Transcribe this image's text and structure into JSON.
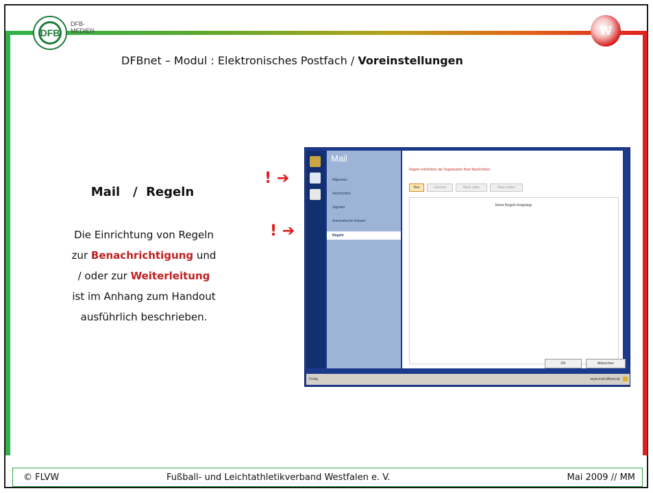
{
  "header": {
    "logo_dfb": "DFB",
    "logo_text_1": "DFB-",
    "logo_text_2": "MEDIEN",
    "logo_right": "W",
    "title_prefix": "DFBnet – Modul :  Elektronisches Postfach  /  ",
    "title_bold": "Voreinstellungen"
  },
  "left": {
    "heading": "Mail   /  Regeln",
    "line1": "Die Einrichtung von Regeln",
    "line2_pre": "zur ",
    "line2_hl": "Benachrichtigung",
    "line2_post": " und",
    "line3_pre": "/ oder zur ",
    "line3_hl": "Weiterleitung",
    "line4": "ist im Anhang zum Handout",
    "line5": "ausführlich beschrieben."
  },
  "pointers": {
    "p1": "! ➔",
    "p2": "! ➔"
  },
  "screenshot": {
    "title": "Mail",
    "items": [
      "Allgemein",
      "Nachrichten",
      "Signatur",
      "Automatische Antwort"
    ],
    "selected": "Regeln",
    "message": "Regeln erleichtern die Organisation Ihrer Nachrichten.",
    "buttons": [
      "Neu",
      "Löschen",
      "Nach oben",
      "Nach unten"
    ],
    "empty": "Keine Regeln festgelegt.",
    "ok": "OK",
    "cancel": "Abbrechen",
    "status_left": "Fertig",
    "status_right": "www.mail.dfbnet.de"
  },
  "footer": {
    "left": "©  FLVW",
    "center": "Fußball- und Leichtathletikverband Westfalen e. V.",
    "right": "Mai 2009  //  MM"
  },
  "colors": {
    "green": "#2fb34a",
    "red": "#e02020",
    "highlight": "#c02020"
  }
}
